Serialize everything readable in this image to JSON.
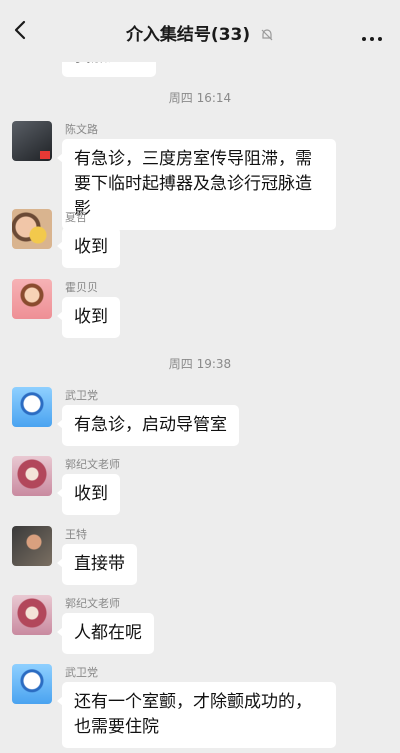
{
  "header": {
    "title": "介入集结号(33)"
  },
  "times": [
    "周四 16:14",
    "周四 19:38"
  ],
  "partial_message": {
    "text": "我加过"
  },
  "messages": [
    {
      "sender": "陈文路",
      "text": "有急诊，三度房室传导阻滞，需要下临时起搏器及急诊行冠脉造影",
      "avatar": "dark"
    },
    {
      "sender": "夏哲",
      "text": "收到",
      "avatar": "child"
    },
    {
      "sender": "霍贝贝",
      "text": "收到",
      "avatar": "cartoon-girl"
    },
    {
      "sender": "武卫党",
      "text": "有急诊，启动导管室",
      "avatar": "cartoon-blue"
    },
    {
      "sender": "郭纪文老师",
      "text": "收到",
      "avatar": "pink-character"
    },
    {
      "sender": "王特",
      "text": "直接带",
      "avatar": "photo"
    },
    {
      "sender": "郭纪文老师",
      "text": "人都在呢",
      "avatar": "pink-character"
    },
    {
      "sender": "武卫党",
      "text": "还有一个室颤，才除颤成功的，也需要住院",
      "avatar": "cartoon-blue"
    }
  ]
}
